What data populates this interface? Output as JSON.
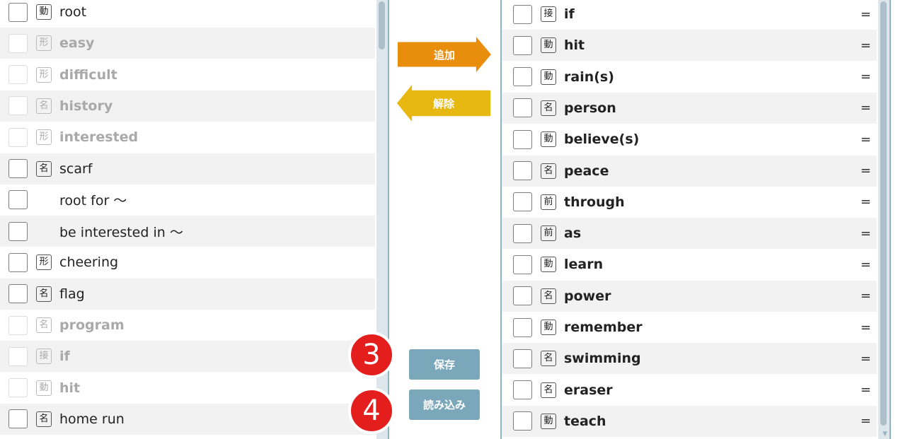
{
  "buttons": {
    "add": "追加",
    "remove": "解除",
    "save": "保存",
    "load": "読み込み"
  },
  "badges": {
    "save_step": "3",
    "load_step": "4"
  },
  "left_list": [
    {
      "pos": "動",
      "word": "root",
      "disabled": false
    },
    {
      "pos": "形",
      "word": "easy",
      "disabled": true
    },
    {
      "pos": "形",
      "word": "difficult",
      "disabled": true
    },
    {
      "pos": "名",
      "word": "history",
      "disabled": true
    },
    {
      "pos": "形",
      "word": "interested",
      "disabled": true
    },
    {
      "pos": "名",
      "word": "scarf",
      "disabled": false
    },
    {
      "pos": "",
      "word": "root for 〜",
      "disabled": false
    },
    {
      "pos": "",
      "word": "be interested in 〜",
      "disabled": false
    },
    {
      "pos": "形",
      "word": "cheering",
      "disabled": false
    },
    {
      "pos": "名",
      "word": "flag",
      "disabled": false
    },
    {
      "pos": "名",
      "word": "program",
      "disabled": true
    },
    {
      "pos": "接",
      "word": "if",
      "disabled": true
    },
    {
      "pos": "動",
      "word": "hit",
      "disabled": true
    },
    {
      "pos": "名",
      "word": "home run",
      "disabled": false
    }
  ],
  "right_list": [
    {
      "pos": "接",
      "word": "if",
      "eq": "="
    },
    {
      "pos": "動",
      "word": "hit",
      "eq": "="
    },
    {
      "pos": "動",
      "word": "rain(s)",
      "eq": "="
    },
    {
      "pos": "名",
      "word": "person",
      "eq": "="
    },
    {
      "pos": "動",
      "word": "believe(s)",
      "eq": "="
    },
    {
      "pos": "名",
      "word": "peace",
      "eq": "="
    },
    {
      "pos": "前",
      "word": "through",
      "eq": "="
    },
    {
      "pos": "前",
      "word": "as",
      "eq": "="
    },
    {
      "pos": "動",
      "word": "learn",
      "eq": "="
    },
    {
      "pos": "名",
      "word": "power",
      "eq": "="
    },
    {
      "pos": "動",
      "word": "remember",
      "eq": "="
    },
    {
      "pos": "名",
      "word": "swimming",
      "eq": "="
    },
    {
      "pos": "名",
      "word": "eraser",
      "eq": "="
    },
    {
      "pos": "動",
      "word": "teach",
      "eq": "="
    }
  ],
  "colors": {
    "add": "#e88e0c",
    "remove": "#e8b812",
    "flat_button": "#7ba7bb",
    "badge": "#e41d1d"
  }
}
